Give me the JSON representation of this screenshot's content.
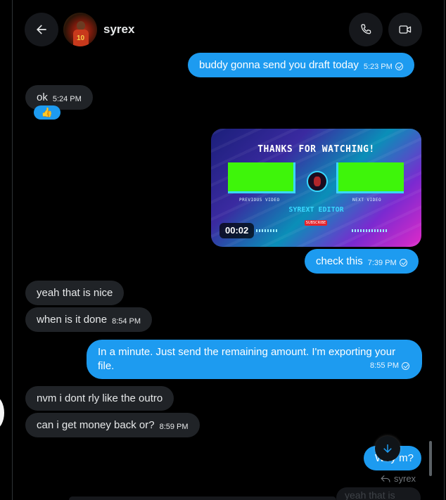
{
  "header": {
    "username": "syrex",
    "avatar_jersey_number": "10",
    "icons": {
      "back": "arrow-left-icon",
      "call": "phone-icon",
      "video": "video-camera-icon"
    }
  },
  "messages": [
    {
      "direction": "out",
      "text": "buddy gonna send you draft today",
      "time": "5:23 PM",
      "status": "seen"
    },
    {
      "direction": "in",
      "text": "ok",
      "time": "5:24 PM",
      "reaction": "👍"
    },
    {
      "direction": "out",
      "type": "video",
      "duration": "00:02",
      "video_frame": {
        "title": "THANKS FOR WATCHING!",
        "left_label": "PREVIOUS VIDEO",
        "right_label": "NEXT VIDEO",
        "editor_text": "SYREXT EDITOR",
        "subscribe_text": "SUBSCRIBE"
      }
    },
    {
      "direction": "out",
      "text": "check this",
      "time": "7:39 PM",
      "status": "seen"
    },
    {
      "direction": "in",
      "text": "yeah that is nice",
      "time": ""
    },
    {
      "direction": "in",
      "text": "when is it done",
      "time": "8:54 PM"
    },
    {
      "direction": "out",
      "text": "In a minute. Just send the remaining amount. I'm exporting your file.",
      "time": "8:55 PM",
      "status": "seen"
    },
    {
      "direction": "in",
      "text": "nvm i dont rly like the outro",
      "time": ""
    },
    {
      "direction": "in",
      "text": "can i get money back or?",
      "time": "8:59 PM"
    },
    {
      "direction": "out",
      "text": "Why m?",
      "time": ""
    }
  ],
  "reply_indicator": {
    "to": "syrex"
  },
  "ghost_preview": {
    "text": "yeah that is nice"
  },
  "colors": {
    "outgoing_bubble": "#1d9bf0",
    "incoming_bubble": "#202327",
    "background": "#000000"
  }
}
